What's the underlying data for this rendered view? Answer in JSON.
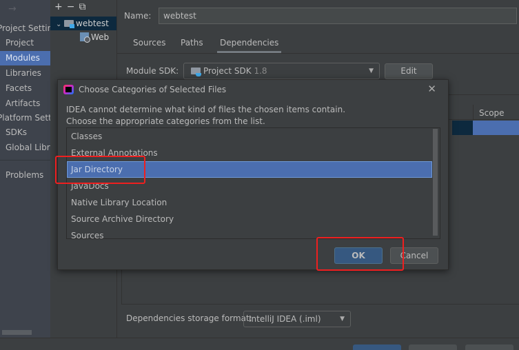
{
  "nav": {
    "back_icon": "arrow-right-icon",
    "section_project": "Project Settings",
    "section_platform": "Platform Settings",
    "items": [
      {
        "label": "Project",
        "selected": false
      },
      {
        "label": "Modules",
        "selected": true
      },
      {
        "label": "Libraries",
        "selected": false
      },
      {
        "label": "Facets",
        "selected": false
      },
      {
        "label": "Artifacts",
        "selected": false
      },
      {
        "label": "SDKs",
        "selected": false
      },
      {
        "label": "Global Libraries",
        "selected": false
      },
      {
        "label": "Problems",
        "selected": false
      }
    ]
  },
  "tree": {
    "toolbar": {
      "add": "+",
      "remove": "−",
      "copy_icon": "copy-icon"
    },
    "nodes": [
      {
        "label": "webtest",
        "expanded": true,
        "selected": true
      },
      {
        "label": "Web",
        "selected": false
      }
    ]
  },
  "module": {
    "name_label": "Name:",
    "name_value": "webtest",
    "tabs": [
      {
        "label": "Sources",
        "active": false
      },
      {
        "label": "Paths",
        "active": false
      },
      {
        "label": "Dependencies",
        "active": true
      }
    ],
    "sdk_label": "Module SDK:",
    "sdk_value": "Project SDK",
    "sdk_version": "1.8",
    "edit_label": "Edit",
    "deps_columns": {
      "scope": "Scope"
    },
    "storage_label": "Dependencies storage format:",
    "storage_value": "IntelliJ IDEA (.iml)"
  },
  "dialog": {
    "title": "Choose Categories of Selected Files",
    "message_line1": "IDEA cannot determine what kind of files the chosen items contain.",
    "message_line2": "Choose the appropriate categories from the list.",
    "categories": [
      {
        "label": "Classes",
        "selected": false
      },
      {
        "label": "External Annotations",
        "selected": false
      },
      {
        "label": "Jar Directory",
        "selected": true
      },
      {
        "label": "JavaDocs",
        "selected": false
      },
      {
        "label": "Native Library Location",
        "selected": false
      },
      {
        "label": "Source Archive Directory",
        "selected": false
      },
      {
        "label": "Sources",
        "selected": false
      }
    ],
    "ok_label": "OK",
    "cancel_label": "Cancel"
  },
  "colors": {
    "selection": "#4b6eaf",
    "annotation": "#ef1f1f",
    "ok_button": "#365880",
    "background": "#3c3f41"
  }
}
